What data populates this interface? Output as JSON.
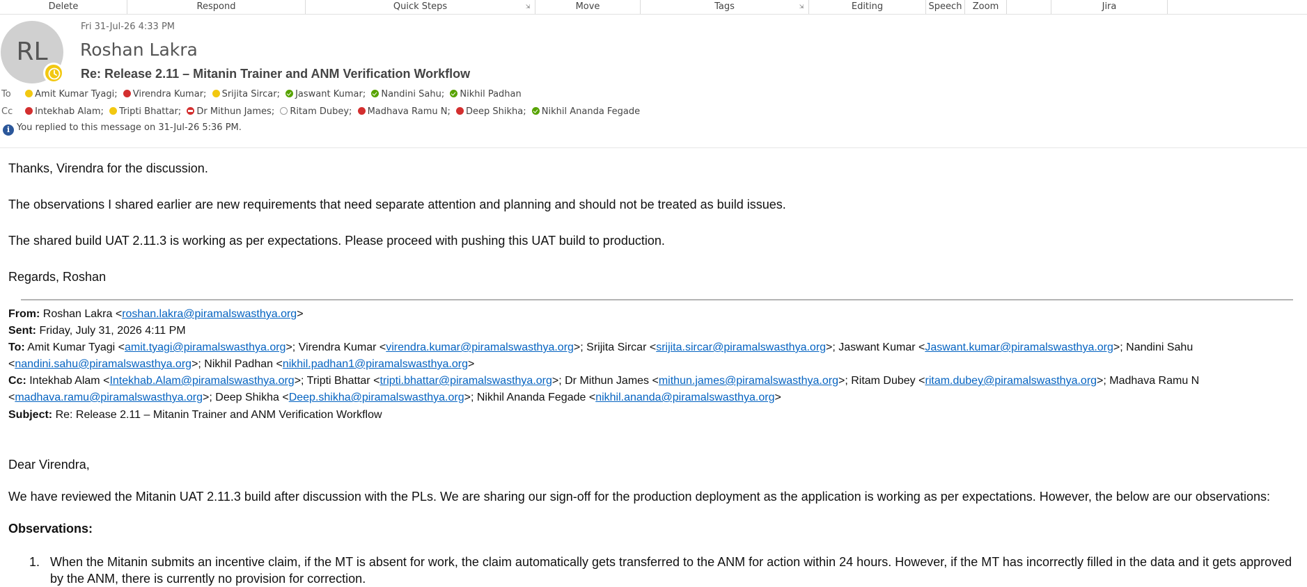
{
  "ribbon": {
    "groups": [
      "Delete",
      "Respond",
      "Quick Steps",
      "Move",
      "Tags",
      "Editing",
      "Speech",
      "Zoom",
      "",
      "Jira"
    ]
  },
  "header": {
    "avatar_initials": "RL",
    "sent": "Fri 31-Jul-26 4:33 PM",
    "sender": "Roshan Lakra",
    "subject": "Re: Release 2.11 – Mitanin Trainer and ANM Verification Workflow",
    "to_label": "To",
    "cc_label": "Cc",
    "to": [
      {
        "name": "Amit Kumar Tyagi;",
        "status": "away"
      },
      {
        "name": "Virendra Kumar;",
        "status": "busy"
      },
      {
        "name": "Srijita Sircar;",
        "status": "away"
      },
      {
        "name": "Jaswant Kumar;",
        "status": "avail"
      },
      {
        "name": "Nandini Sahu;",
        "status": "avail"
      },
      {
        "name": "Nikhil Padhan",
        "status": "avail"
      }
    ],
    "cc": [
      {
        "name": "Intekhab Alam;",
        "status": "busy"
      },
      {
        "name": "Tripti Bhattar;",
        "status": "away"
      },
      {
        "name": "Dr Mithun James;",
        "status": "dnd"
      },
      {
        "name": "Ritam Dubey;",
        "status": "offline"
      },
      {
        "name": "Madhava Ramu N;",
        "status": "busy"
      },
      {
        "name": "Deep Shikha;",
        "status": "busy"
      },
      {
        "name": "Nikhil Ananda Fegade",
        "status": "avail"
      }
    ],
    "info": "You replied to this message on 31-Jul-26 5:36 PM."
  },
  "body": {
    "p1": "Thanks, Virendra for the discussion.",
    "p2": "The observations I shared earlier are new requirements that need separate attention and planning and should not be treated as build issues.",
    "p3": "The shared build UAT 2.11.3 is working as per expectations. Please proceed with pushing this UAT build to production.",
    "p4": "Regards, Roshan"
  },
  "quoted": {
    "from_label": "From:",
    "from_name": "Roshan Lakra <",
    "from_email": "roshan.lakra@piramalswasthya.org",
    "sent_label": "Sent:",
    "sent_value": "Friday, July 31, 2026 4:11 PM",
    "to_label": "To:",
    "cc_label": "Cc:",
    "to": [
      {
        "name": "Amit Kumar Tyagi",
        "email": "amit.tyagi@piramalswasthya.org"
      },
      {
        "name": "Virendra Kumar",
        "email": "virendra.kumar@piramalswasthya.org"
      },
      {
        "name": "Srijita Sircar",
        "email": "srijita.sircar@piramalswasthya.org"
      },
      {
        "name": "Jaswant Kumar",
        "email": "Jaswant.kumar@piramalswasthya.org"
      },
      {
        "name": "Nandini Sahu",
        "email": "nandini.sahu@piramalswasthya.org"
      },
      {
        "name": "Nikhil Padhan",
        "email": "nikhil.padhan1@piramalswasthya.org"
      }
    ],
    "cc": [
      {
        "name": "Intekhab Alam",
        "email": "Intekhab.Alam@piramalswasthya.org"
      },
      {
        "name": "Tripti Bhattar",
        "email": "tripti.bhattar@piramalswasthya.org"
      },
      {
        "name": "Dr Mithun James",
        "email": "mithun.james@piramalswasthya.org"
      },
      {
        "name": "Ritam Dubey",
        "email": "ritam.dubey@piramalswasthya.org"
      },
      {
        "name": "Madhava Ramu N",
        "email": "madhava.ramu@piramalswasthya.org"
      },
      {
        "name": "Deep Shikha",
        "email": "Deep.shikha@piramalswasthya.org"
      },
      {
        "name": "Nikhil Ananda Fegade",
        "email": "nikhil.ananda@piramalswasthya.org"
      }
    ],
    "subject_label": "Subject:",
    "subject_value": "Re: Release 2.11 – Mitanin Trainer and ANM Verification Workflow",
    "greeting": "Dear Virendra,",
    "intro": "We have reviewed the Mitanin UAT 2.11.3 build after discussion with the PLs. We are sharing our sign-off for the production deployment as the application is working as per expectations. However, the below are our observations:",
    "obs_heading": "Observations:",
    "observations": [
      {
        "num": "1.",
        "text": "When the Mitanin submits an incentive claim, if the MT is absent for work, the claim automatically gets transferred to the ANM for action within 24 hours. However, if the MT has incorrectly filled in the data and it gets approved by the ANM, there is currently no provision for correction."
      }
    ]
  }
}
